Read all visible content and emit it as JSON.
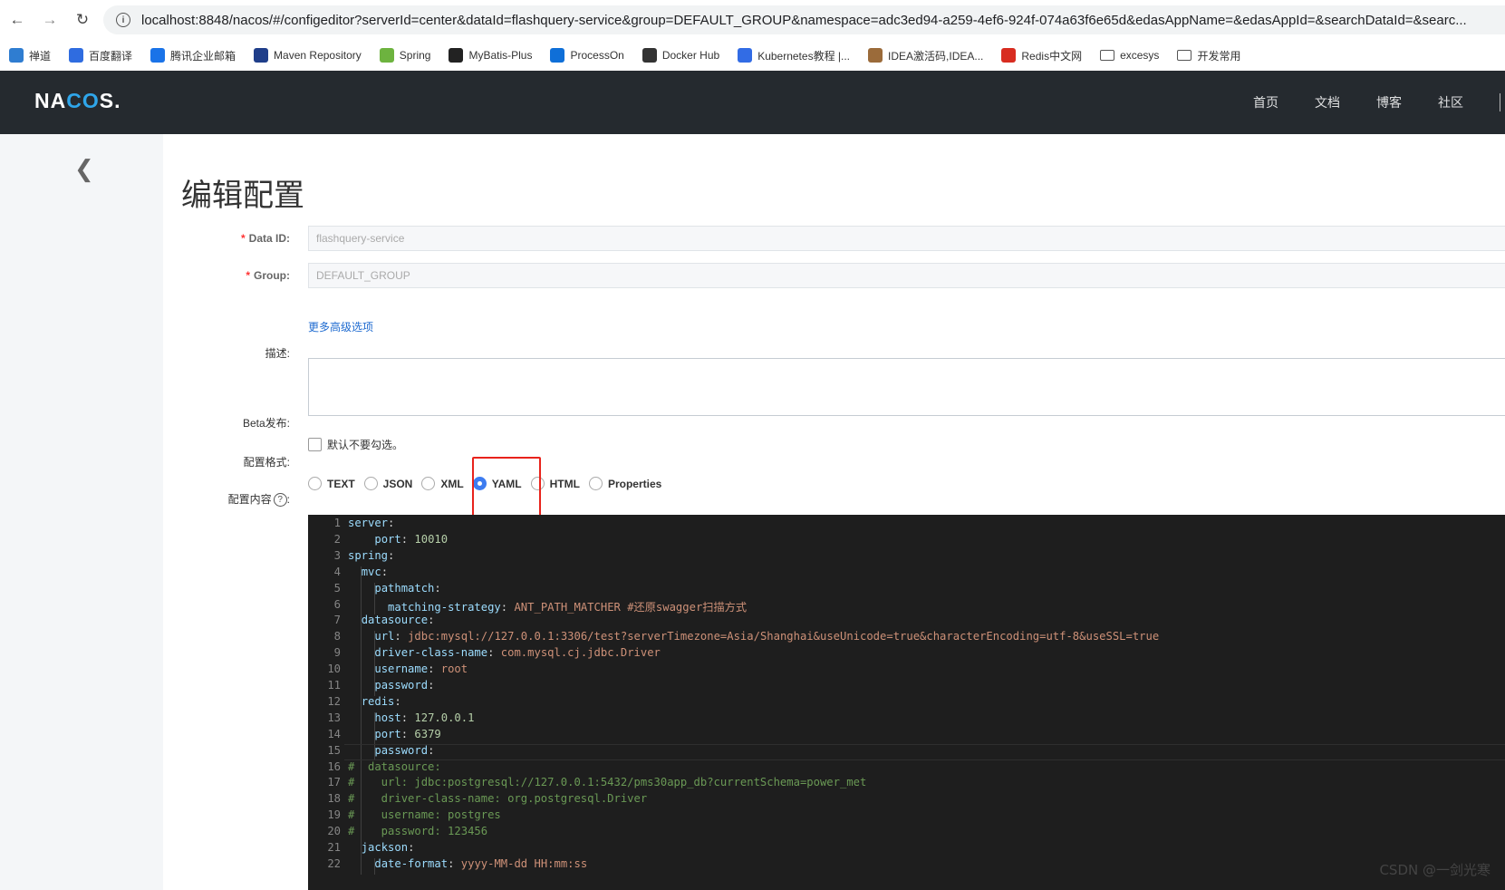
{
  "browser": {
    "url": "localhost:8848/nacos/#/configeditor?serverId=center&dataId=flashquery-service&group=DEFAULT_GROUP&namespace=adc3ed94-a259-4ef6-924f-074a63f6e65d&edasAppName=&edasAppId=&searchDataId=&searc...",
    "bookmarks": [
      {
        "label": "禅道",
        "icon": "chandao-icon",
        "color": "#2f7dd1"
      },
      {
        "label": "百度翻译",
        "icon": "baidu-translate-icon",
        "color": "#2f6ce0"
      },
      {
        "label": "腾讯企业邮箱",
        "icon": "tencent-mail-icon",
        "color": "#1a73e8"
      },
      {
        "label": "Maven Repository",
        "icon": "maven-icon",
        "color": "#1f3e8a"
      },
      {
        "label": "Spring",
        "icon": "spring-icon",
        "color": "#6db33f"
      },
      {
        "label": "MyBatis-Plus",
        "icon": "mybatis-icon",
        "color": "#222222"
      },
      {
        "label": "ProcessOn",
        "icon": "processon-icon",
        "color": "#0f6fd8"
      },
      {
        "label": "Docker Hub",
        "icon": "docker-icon",
        "color": "#333333"
      },
      {
        "label": "Kubernetes教程 |...",
        "icon": "kubernetes-icon",
        "color": "#326ce5"
      },
      {
        "label": "IDEA激活码,IDEA...",
        "icon": "idea-icon",
        "color": "#9b6b3a"
      },
      {
        "label": "Redis中文网",
        "icon": "redis-icon",
        "color": "#d82c20"
      },
      {
        "label": "excesys",
        "icon": "folder-icon",
        "color": ""
      },
      {
        "label": "开发常用",
        "icon": "folder-icon",
        "color": ""
      }
    ]
  },
  "header": {
    "logo": {
      "part1": "NA",
      "part2": "C",
      "part3": "O",
      "part4": "S."
    },
    "nav": [
      "首页",
      "文档",
      "博客",
      "社区"
    ]
  },
  "page": {
    "title": "编辑配置",
    "data_id_label": "Data ID:",
    "data_id_value": "flashquery-service",
    "group_label": "Group:",
    "group_value": "DEFAULT_GROUP",
    "advanced_link": "更多高级选项",
    "description_label": "描述:",
    "beta_label": "Beta发布:",
    "beta_checkbox_text": "默认不要勾选。",
    "format_label": "配置格式:",
    "formats": [
      "TEXT",
      "JSON",
      "XML",
      "YAML",
      "HTML",
      "Properties"
    ],
    "selected_format": "YAML",
    "content_label": "配置内容",
    "help_glyph": "?"
  },
  "editor": {
    "lines": [
      [
        [
          "k",
          "server"
        ],
        [
          "p",
          ":"
        ]
      ],
      [
        [
          "s",
          "    "
        ],
        [
          "k",
          "port"
        ],
        [
          "p",
          ": "
        ],
        [
          "n",
          "10010"
        ]
      ],
      [
        [
          "k",
          "spring"
        ],
        [
          "p",
          ":"
        ]
      ],
      [
        [
          "s",
          "  "
        ],
        [
          "k",
          "mvc"
        ],
        [
          "p",
          ":"
        ]
      ],
      [
        [
          "s",
          "    "
        ],
        [
          "k",
          "pathmatch"
        ],
        [
          "p",
          ":"
        ]
      ],
      [
        [
          "s",
          "      "
        ],
        [
          "k",
          "matching-strategy"
        ],
        [
          "p",
          ": "
        ],
        [
          "v",
          "ANT_PATH_MATCHER #还原swagger扫描方式"
        ]
      ],
      [
        [
          "s",
          "  "
        ],
        [
          "k",
          "datasource"
        ],
        [
          "p",
          ":"
        ]
      ],
      [
        [
          "s",
          "    "
        ],
        [
          "k",
          "url"
        ],
        [
          "p",
          ": "
        ],
        [
          "v",
          "jdbc:mysql://127.0.0.1:3306/test?serverTimezone=Asia/Shanghai&useUnicode=true&characterEncoding=utf-8&useSSL=true"
        ]
      ],
      [
        [
          "s",
          "    "
        ],
        [
          "k",
          "driver-class-name"
        ],
        [
          "p",
          ": "
        ],
        [
          "v",
          "com.mysql.cj.jdbc.Driver"
        ]
      ],
      [
        [
          "s",
          "    "
        ],
        [
          "k",
          "username"
        ],
        [
          "p",
          ": "
        ],
        [
          "v",
          "root"
        ]
      ],
      [
        [
          "s",
          "    "
        ],
        [
          "k",
          "password"
        ],
        [
          "p",
          ":"
        ]
      ],
      [
        [
          "s",
          "  "
        ],
        [
          "k",
          "redis"
        ],
        [
          "p",
          ":"
        ]
      ],
      [
        [
          "s",
          "    "
        ],
        [
          "k",
          "host"
        ],
        [
          "p",
          ": "
        ],
        [
          "n",
          "127.0.0.1"
        ]
      ],
      [
        [
          "s",
          "    "
        ],
        [
          "k",
          "port"
        ],
        [
          "p",
          ": "
        ],
        [
          "n",
          "6379"
        ]
      ],
      [
        [
          "s",
          "    "
        ],
        [
          "k",
          "password"
        ],
        [
          "p",
          ":"
        ]
      ],
      [
        [
          "c",
          "#  datasource:"
        ]
      ],
      [
        [
          "c",
          "#    url: jdbc:postgresql://127.0.0.1:5432/pms30app_db?currentSchema=power_met"
        ]
      ],
      [
        [
          "c",
          "#    driver-class-name: org.postgresql.Driver"
        ]
      ],
      [
        [
          "c",
          "#    username: postgres"
        ]
      ],
      [
        [
          "c",
          "#    password: 123456"
        ]
      ],
      [
        [
          "s",
          "  "
        ],
        [
          "k",
          "jackson"
        ],
        [
          "p",
          ":"
        ]
      ],
      [
        [
          "s",
          "    "
        ],
        [
          "k",
          "date-format"
        ],
        [
          "p",
          ": "
        ],
        [
          "v",
          "yyyy-MM-dd HH:mm:ss"
        ]
      ]
    ]
  },
  "watermark": "CSDN @一剑光寒"
}
